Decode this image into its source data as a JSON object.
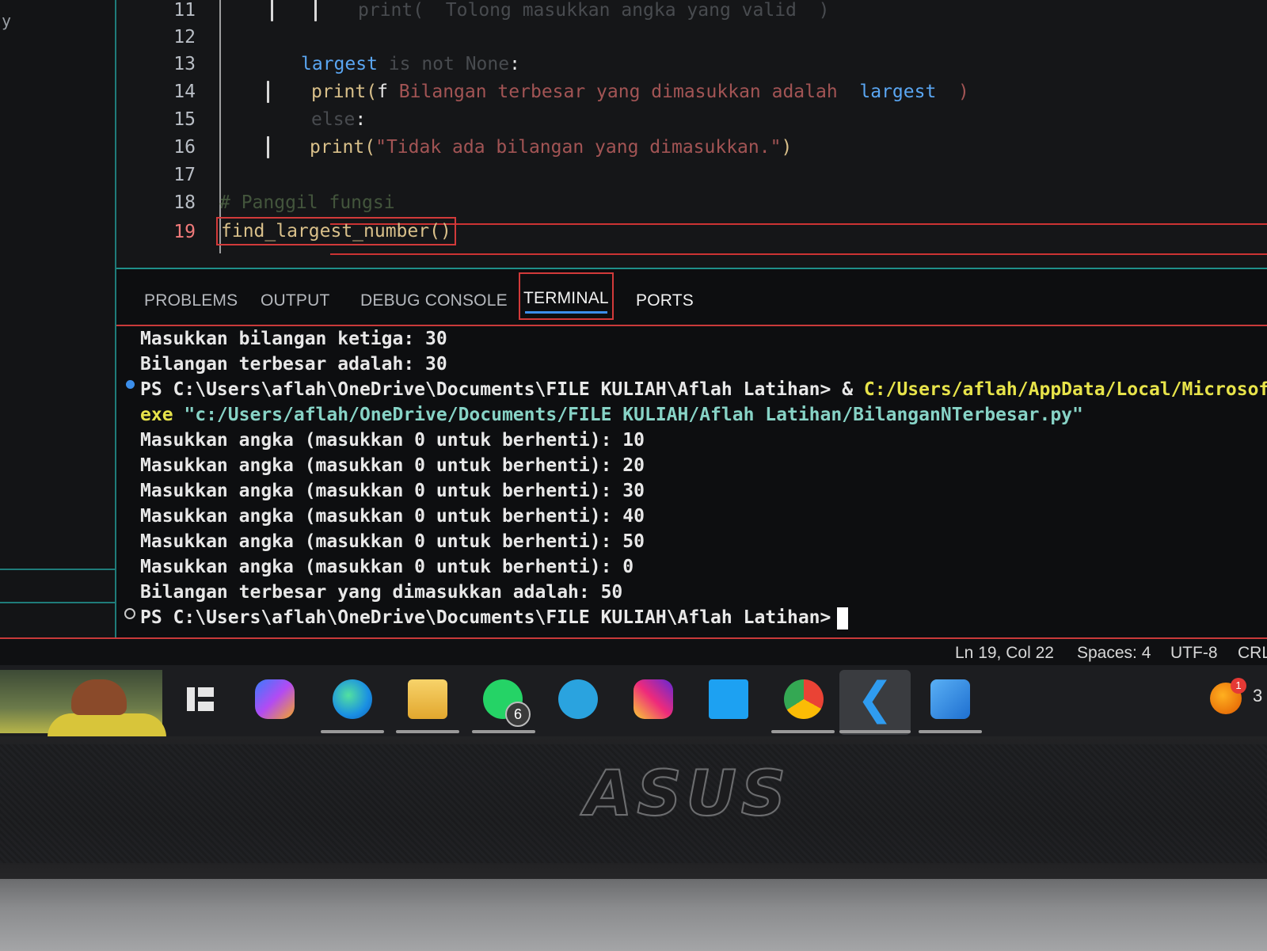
{
  "editor": {
    "lines": [
      {
        "num": "11",
        "tokens": [
          {
            "cls": "dim",
            "text": "print(  Tolong masukkan angka yang valid  )"
          }
        ]
      },
      {
        "num": "12",
        "tokens": []
      },
      {
        "num": "13",
        "tokens": [
          {
            "cls": "var",
            "text": "largest"
          },
          {
            "cls": "dim",
            "text": " is not None"
          },
          {
            "cls": "plain",
            "text": ":"
          }
        ]
      },
      {
        "num": "14",
        "tokens": [
          {
            "cls": "kw-fn",
            "text": "print("
          },
          {
            "cls": "plain",
            "text": "f"
          },
          {
            "cls": "str",
            "text": " Bilangan terbesar yang dimasukkan adalah  "
          },
          {
            "cls": "var",
            "text": "largest"
          },
          {
            "cls": "str",
            "text": "  )"
          }
        ]
      },
      {
        "num": "15",
        "tokens": [
          {
            "cls": "dim",
            "text": "else"
          },
          {
            "cls": "plain",
            "text": ":"
          }
        ]
      },
      {
        "num": "16",
        "tokens": [
          {
            "cls": "kw-fn",
            "text": "print("
          },
          {
            "cls": "str",
            "text": "\"Tidak ada bilangan yang dimasukkan.\""
          },
          {
            "cls": "kw-fn",
            "text": ")"
          }
        ]
      },
      {
        "num": "17",
        "tokens": []
      },
      {
        "num": "18",
        "tokens": [
          {
            "cls": "comment",
            "text": "# Panggil fungsi"
          }
        ]
      },
      {
        "num": "19",
        "tokens": [
          {
            "cls": "kw-fn",
            "text": "find_largest_number()"
          }
        ]
      }
    ]
  },
  "panel": {
    "tabs": [
      "PROBLEMS",
      "OUTPUT",
      "DEBUG CONSOLE",
      "TERMINAL",
      "PORTS"
    ],
    "active_tab": "TERMINAL"
  },
  "terminal": {
    "line_prev1": "Masukkan bilangan ketiga: 30",
    "line_prev2": "Bilangan terbesar adalah: 30",
    "prompt_path": "PS C:\\Users\\aflah\\OneDrive\\Documents\\FILE KULIAH\\Aflah Latihan> ",
    "cmd_amp": "& ",
    "cmd_python": "C:/Users/aflah/AppData/Local/Microsoft/Wi",
    "cmd_exe": "exe ",
    "cmd_script": "\"c:/Users/aflah/OneDrive/Documents/FILE KULIAH/Aflah Latihan/BilanganNTerbesar.py\"",
    "inputs": [
      "Masukkan angka (masukkan 0 untuk berhenti): 10",
      "Masukkan angka (masukkan 0 untuk berhenti): 20",
      "Masukkan angka (masukkan 0 untuk berhenti): 30",
      "Masukkan angka (masukkan 0 untuk berhenti): 40",
      "Masukkan angka (masukkan 0 untuk berhenti): 50",
      "Masukkan angka (masukkan 0 untuk berhenti): 0"
    ],
    "result": "Bilangan terbesar yang dimasukkan adalah: 50",
    "final_prompt": "PS C:\\Users\\aflah\\OneDrive\\Documents\\FILE KULIAH\\Aflah Latihan>"
  },
  "statusbar": {
    "position": "Ln 19, Col 22",
    "spaces": "Spaces: 4",
    "encoding": "UTF-8",
    "eol": "CRL"
  },
  "taskbar": {
    "icons": [
      "task-view-icon",
      "copilot-icon",
      "edge-icon",
      "file-explorer-icon",
      "whatsapp-icon",
      "telegram-icon",
      "instagram-icon",
      "twitter-icon",
      "chrome-icon",
      "vscode-icon",
      "photos-icon"
    ],
    "whatsapp_badge": "6",
    "notification_badge": "1",
    "clock_partial": "3"
  },
  "laptop": {
    "brand": "ASUS"
  },
  "colors": {
    "accent_teal": "#1f8f8a",
    "error_red": "#d23a3a",
    "terminal_yellow": "#e7e34a",
    "terminal_cyan": "#87d3c6"
  }
}
